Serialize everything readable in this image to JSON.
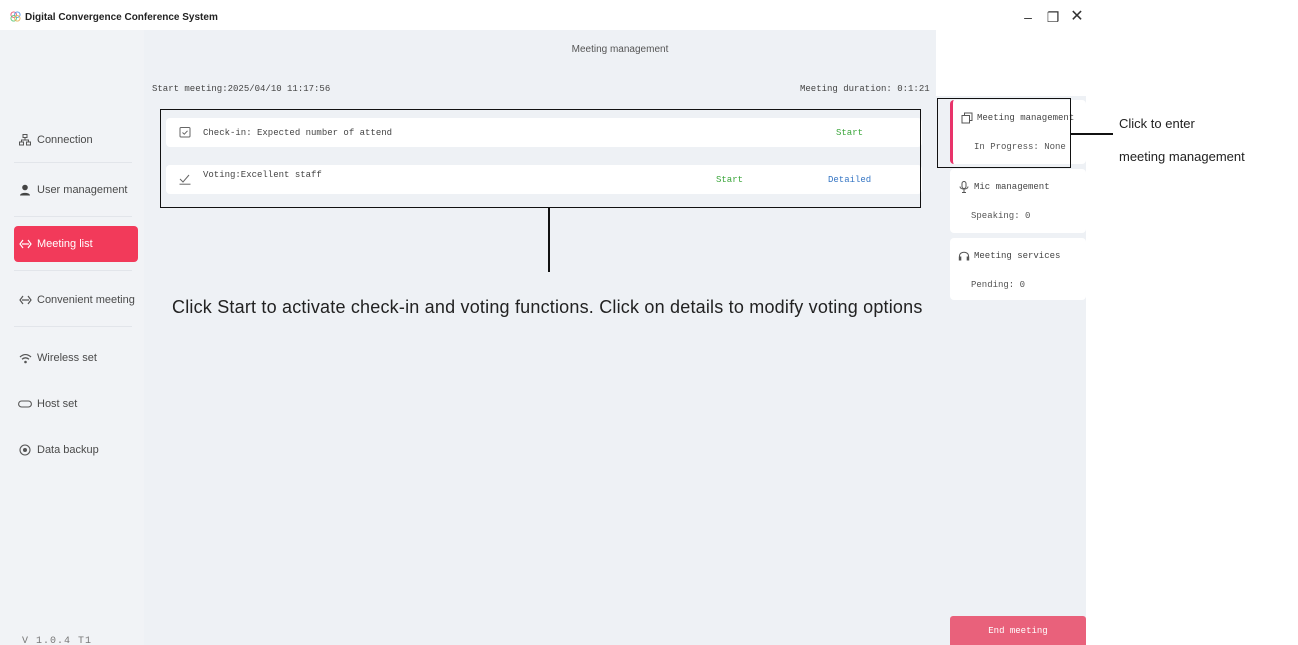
{
  "window": {
    "title": "Digital Convergence Conference System",
    "min_glyph": "–",
    "max_glyph": "❐",
    "close_glyph": "✕"
  },
  "sidebar": {
    "items": [
      {
        "label": "Connection",
        "icon": "network-icon",
        "active": false
      },
      {
        "label": "User management",
        "icon": "user-icon",
        "active": false
      },
      {
        "label": "Meeting list",
        "icon": "meeting-list-icon",
        "active": true
      },
      {
        "label": "Convenient meeting",
        "icon": "convenient-meeting-icon",
        "active": false
      },
      {
        "label": "Wireless set",
        "icon": "wifi-icon",
        "active": false
      },
      {
        "label": "Host set",
        "icon": "host-icon",
        "active": false
      },
      {
        "label": "Data backup",
        "icon": "backup-icon",
        "active": false
      }
    ],
    "version": "V 1.0.4 T1"
  },
  "main": {
    "title": "Meeting management",
    "start_meeting": "Start meeting:2025/04/10 11:17:56",
    "duration": "Meeting duration: 0:1:21",
    "rows": [
      {
        "label": "Check-in: Expected number of attend",
        "start": "Start"
      },
      {
        "label": "Voting:Excellent staff",
        "start": "Start",
        "detail": "Detailed"
      }
    ]
  },
  "right_panel": {
    "cards": [
      {
        "title": "Meeting management",
        "status": "In Progress: None"
      },
      {
        "title": "Mic management",
        "status": "Speaking: 0"
      },
      {
        "title": "Meeting services",
        "status": "Pending:  0"
      }
    ],
    "end_button": "End meeting"
  },
  "annotations": {
    "enter_line1": "Click to enter",
    "enter_line2": "meeting management",
    "main_note": "Click Start to activate check-in and voting functions. Click on details to modify voting options"
  },
  "colors": {
    "accent": "#f23a5a",
    "end_button": "#e9617b",
    "start_green": "#3aa53a",
    "detail_blue": "#3676c4",
    "sidebar_bg": "#f1f3f6",
    "main_bg": "#eef1f5"
  }
}
